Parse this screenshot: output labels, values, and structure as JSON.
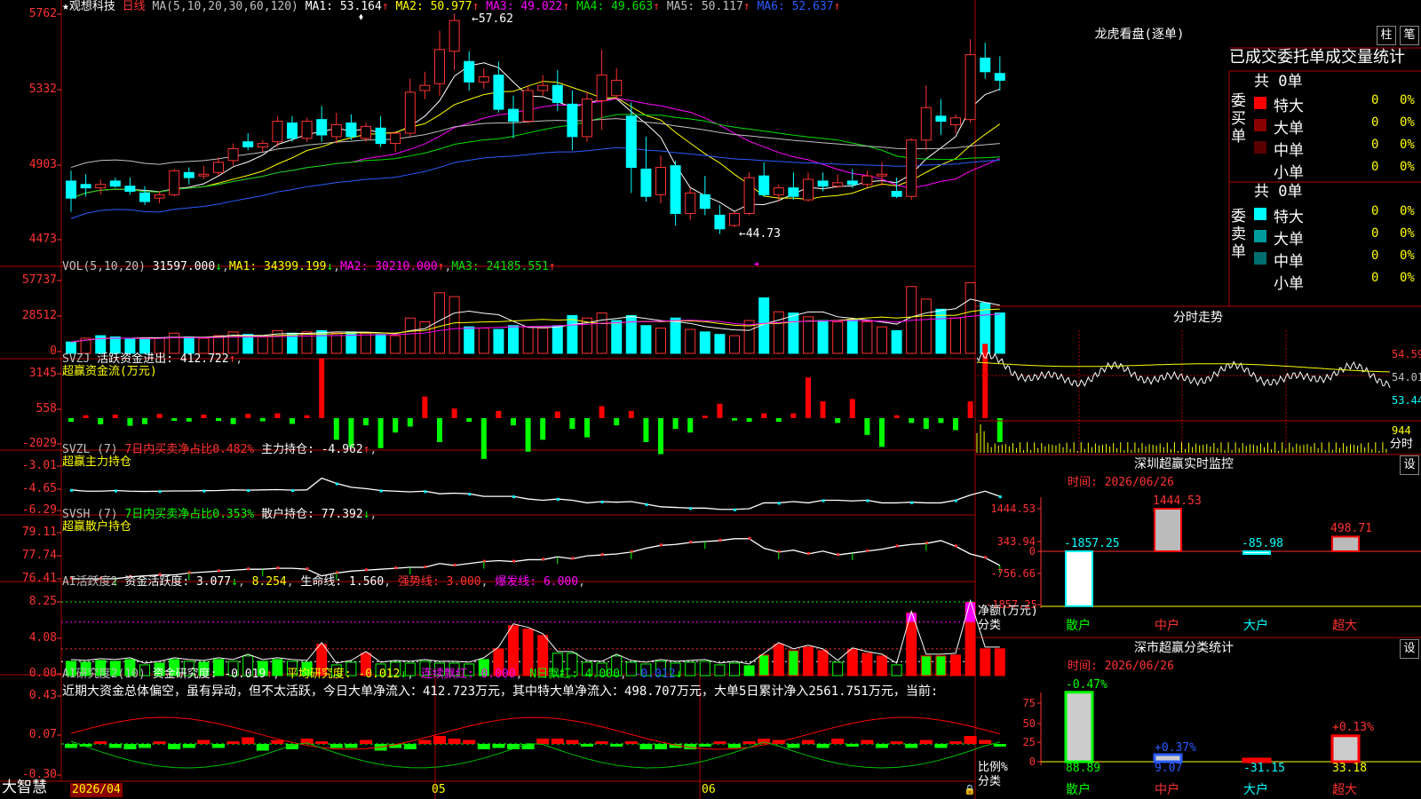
{
  "main": {
    "title_star": "★",
    "stock_name": "观想科技",
    "period": "日线",
    "ma_label": "MA(5,10,20,30,60,120)",
    "ma_values": [
      {
        "t": "MA1: 53.164",
        "c": "#ffffff"
      },
      {
        "t": "MA2: 50.977",
        "c": "#ffff00"
      },
      {
        "t": "MA3: 49.022",
        "c": "#ff00ff"
      },
      {
        "t": "MA4: 49.663",
        "c": "#00e000"
      },
      {
        "t": "MA5: 50.117",
        "c": "#c0c0c0"
      },
      {
        "t": "MA6: 52.637",
        "c": "#2a5cff"
      }
    ],
    "y_ticks": [
      "5762",
      "5332",
      "4903",
      "4473"
    ],
    "high_label": "←57.62",
    "low_label": "←44.73"
  },
  "vol": {
    "label": "VOL(5,10,20)",
    "v": "31597.000",
    "ma1": "MA1: 34399.199",
    "ma2": "MA2: 30210.000",
    "ma3": "MA3: 24185.551",
    "y_ticks": [
      "57737",
      "28512",
      "0"
    ]
  },
  "svzj": {
    "label": "SVZJ",
    "sub": "活跃资金进出: 412.722",
    "title2": "超赢资金流(万元)",
    "y_ticks": [
      "3145",
      "558",
      "-2029"
    ]
  },
  "svzl": {
    "label": "SVZL (7)",
    "sub1": "7日内买卖净占比0.482%",
    "sub2": "主力持仓: -4.962",
    "title2": "超赢主力持仓",
    "y_ticks": [
      "-3.01",
      "-4.65",
      "-6.29"
    ]
  },
  "svsh": {
    "label": "SVSH (7)",
    "sub1": "7日内买卖净占比0.353%",
    "sub2": "散户持仓: 77.392",
    "title2": "超赢散户持仓",
    "y_ticks": [
      "79.11",
      "77.74",
      "76.41"
    ]
  },
  "ai1": {
    "label": "AI活跃度2",
    "a": "资金活跃度: 3.077",
    "b": "8.254",
    "c": "生命线: 1.560",
    "d": "强势线: 3.000",
    "e": "爆发线: 6.000",
    "y_ticks": [
      "8.25",
      "4.08",
      "0.00"
    ]
  },
  "ai2": {
    "label": "AI研究度2(10)",
    "a": "资金研究度: -0.019",
    "b": "平均研究度: -0.012",
    "c": "连续飘红: 0.000",
    "d": "N日飘红: 4.000",
    "e": "-0.012",
    "text": "近期大资金总体偏空，虽有异动，但不太活跃，今日大单净流入：412.723万元，其中特大单净流入：498.707万元，大单5日累计净入2561.751万元，当前:",
    "y_ticks": [
      "0.43",
      "0.07",
      "-0.30"
    ]
  },
  "footer": {
    "brand": "大智慧",
    "date": "2026/04",
    "m5": "05",
    "m6": "06"
  },
  "right": {
    "lhb_title": "龙虎看盘(逐单)",
    "btn1": "柱",
    "btn2": "笔",
    "tabs": "已成交委托单成交量统计",
    "buy_label": "委买单",
    "buy_total": "共 0单",
    "sell_label": "委卖单",
    "sell_total": "共 0单",
    "buy_rows": [
      {
        "n": "特大",
        "c": "#ff0000",
        "v": "0",
        "p": "0%"
      },
      {
        "n": "大单",
        "c": "#8b0000",
        "v": "0",
        "p": "0%"
      },
      {
        "n": "中单",
        "c": "#5a0000",
        "v": "0",
        "p": "0%"
      },
      {
        "n": "小单",
        "c": "#000000",
        "v": "0",
        "p": "0%"
      }
    ],
    "sell_rows": [
      {
        "n": "特大",
        "c": "#00ffff",
        "v": "0",
        "p": "0%"
      },
      {
        "n": "大单",
        "c": "#009c9c",
        "v": "0",
        "p": "0%"
      },
      {
        "n": "中单",
        "c": "#006e6e",
        "v": "0",
        "p": "0%"
      },
      {
        "n": "小单",
        "c": "#000000",
        "v": "0",
        "p": "0%"
      }
    ],
    "fs_title": "分时走势",
    "fs_y": [
      "54.59",
      "54.01",
      "53.44"
    ],
    "fs_vol": "944",
    "fs_tag": "分时",
    "sz_title": "深圳超赢实时监控",
    "sz_btn": "设",
    "sz_time": "时间: 2026/06/26",
    "sz_y": [
      "1444.53",
      "343.94",
      "0",
      "-756.66",
      "-1857.25"
    ],
    "sz_vals": [
      "-1857.25",
      "1444.53",
      "-85.98",
      "498.71"
    ],
    "sz_unit": "净额(万元)",
    "sz_cat": "分类",
    "cats": [
      "散户",
      "中户",
      "大户",
      "超大"
    ],
    "cls_title": "深市超赢分类统计",
    "cls_btn": "设",
    "cls_time": "时间: 2026/06/26",
    "cls_y": [
      "75",
      "50",
      "25",
      "0"
    ],
    "cls_pct": [
      "-0.47%",
      "+0.37%",
      "+0.13%"
    ],
    "cls_vals": [
      "88.89",
      "9.07",
      "-31.15",
      "33.18"
    ],
    "cls_unit": "比例%",
    "cls_cat": "分类"
  },
  "chart_data": [
    {
      "type": "candlestick",
      "title": "观想科技 日线",
      "series": "price",
      "ylim": [
        44.0,
        58.0
      ],
      "x_labels": [
        "2026/04",
        "05",
        "06"
      ],
      "ohlc": [
        [
          47.8,
          48.4,
          46.0,
          46.8
        ],
        [
          47.6,
          48.2,
          46.9,
          47.4
        ],
        [
          47.4,
          47.9,
          47.0,
          47.6
        ],
        [
          47.8,
          48.0,
          47.4,
          47.5
        ],
        [
          47.5,
          48.0,
          47.0,
          47.2
        ],
        [
          47.1,
          47.5,
          46.4,
          46.6
        ],
        [
          46.8,
          47.2,
          46.5,
          47.0
        ],
        [
          47.0,
          48.5,
          46.9,
          48.4
        ],
        [
          48.3,
          48.6,
          47.6,
          48.0
        ],
        [
          48.1,
          48.7,
          47.9,
          48.2
        ],
        [
          48.3,
          49.2,
          48.1,
          48.9
        ],
        [
          49.0,
          50.0,
          48.7,
          49.7
        ],
        [
          50.1,
          50.6,
          49.6,
          49.8
        ],
        [
          49.8,
          50.2,
          49.5,
          50.0
        ],
        [
          50.1,
          51.6,
          49.8,
          51.3
        ],
        [
          51.2,
          51.6,
          50.1,
          50.3
        ],
        [
          50.3,
          51.5,
          50.1,
          51.3
        ],
        [
          51.4,
          52.2,
          50.1,
          50.5
        ],
        [
          50.4,
          51.8,
          50.0,
          51.1
        ],
        [
          51.2,
          51.7,
          50.2,
          50.4
        ],
        [
          50.3,
          51.2,
          50.1,
          51.0
        ],
        [
          50.9,
          51.6,
          49.8,
          50.0
        ],
        [
          50.0,
          50.7,
          49.5,
          50.6
        ],
        [
          50.6,
          53.8,
          50.4,
          53.0
        ],
        [
          53.1,
          54.2,
          52.6,
          53.4
        ],
        [
          53.5,
          56.6,
          52.8,
          55.5
        ],
        [
          55.4,
          57.6,
          54.3,
          57.2
        ],
        [
          54.8,
          55.4,
          53.1,
          53.6
        ],
        [
          53.6,
          54.4,
          53.2,
          53.9
        ],
        [
          54.0,
          54.8,
          51.8,
          52.0
        ],
        [
          52.0,
          52.8,
          50.3,
          51.3
        ],
        [
          51.3,
          53.4,
          51.2,
          53.1
        ],
        [
          53.1,
          54.0,
          52.8,
          53.4
        ],
        [
          53.4,
          54.3,
          51.9,
          52.4
        ],
        [
          52.3,
          53.1,
          49.6,
          50.4
        ],
        [
          50.4,
          53.0,
          50.1,
          52.6
        ],
        [
          52.5,
          55.5,
          50.8,
          54.0
        ],
        [
          52.8,
          54.4,
          52.6,
          53.7
        ],
        [
          51.6,
          52.4,
          47.1,
          48.6
        ],
        [
          48.5,
          50.4,
          46.6,
          46.9
        ],
        [
          47.0,
          49.3,
          46.5,
          48.6
        ],
        [
          48.7,
          49.0,
          45.2,
          45.9
        ],
        [
          45.9,
          47.4,
          45.5,
          47.1
        ],
        [
          47.0,
          48.1,
          45.8,
          46.2
        ],
        [
          45.8,
          46.4,
          44.7,
          45.0
        ],
        [
          45.2,
          46.0,
          45.1,
          45.9
        ],
        [
          45.9,
          48.3,
          45.8,
          48.0
        ],
        [
          48.1,
          48.9,
          46.9,
          47.0
        ],
        [
          47.0,
          47.6,
          46.6,
          47.4
        ],
        [
          47.4,
          48.3,
          46.7,
          46.9
        ],
        [
          46.7,
          48.3,
          46.6,
          47.9
        ],
        [
          47.8,
          48.3,
          47.2,
          47.5
        ],
        [
          47.5,
          48.2,
          47.4,
          47.7
        ],
        [
          47.8,
          48.5,
          47.4,
          47.6
        ],
        [
          47.6,
          48.4,
          47.4,
          48.1
        ],
        [
          48.1,
          48.9,
          47.5,
          48.2
        ],
        [
          47.2,
          48.0,
          46.8,
          46.9
        ],
        [
          46.9,
          50.3,
          46.7,
          50.2
        ],
        [
          50.2,
          53.4,
          49.6,
          52.1
        ],
        [
          51.6,
          52.6,
          50.5,
          51.3
        ],
        [
          51.1,
          51.7,
          50.6,
          51.5
        ],
        [
          51.4,
          56.1,
          51.2,
          55.2
        ],
        [
          55.0,
          55.9,
          53.8,
          54.2
        ],
        [
          54.1,
          55.1,
          53.1,
          53.7
        ]
      ]
    },
    {
      "type": "bar",
      "series": "volume",
      "ylim": [
        0,
        57737
      ],
      "values": [
        9000,
        12000,
        14000,
        13000,
        12000,
        11000,
        12000,
        16000,
        13000,
        12000,
        14000,
        17000,
        15000,
        13000,
        18000,
        16000,
        17000,
        18000,
        16000,
        17000,
        16000,
        15000,
        14000,
        28000,
        25000,
        48000,
        45000,
        21000,
        20000,
        19000,
        22000,
        21000,
        20000,
        22000,
        30000,
        28000,
        32000,
        26000,
        30000,
        22000,
        20000,
        28000,
        19000,
        17000,
        15000,
        14000,
        26000,
        44000,
        33000,
        32000,
        29000,
        26000,
        25000,
        27000,
        25000,
        21000,
        18000,
        53000,
        43000,
        35000,
        28000,
        56000,
        40000,
        32000
      ],
      "up": [
        false,
        true,
        false,
        false,
        false,
        false,
        true,
        true,
        false,
        true,
        true,
        true,
        false,
        true,
        true,
        false,
        true,
        false,
        true,
        false,
        true,
        false,
        true,
        true,
        true,
        true,
        true,
        false,
        true,
        false,
        false,
        true,
        true,
        false,
        false,
        true,
        true,
        false,
        false,
        false,
        true,
        false,
        true,
        false,
        false,
        true,
        true,
        false,
        true,
        false,
        true,
        false,
        true,
        false,
        true,
        true,
        false,
        true,
        true,
        false,
        true,
        true,
        false,
        false
      ]
    },
    {
      "type": "bar",
      "series": "活跃资金进出",
      "ylim": [
        -2029,
        3145
      ],
      "values": [
        -150,
        120,
        -260,
        150,
        -320,
        -250,
        180,
        -110,
        -140,
        150,
        -120,
        -250,
        180,
        -130,
        200,
        -240,
        120,
        2500,
        -900,
        -1200,
        -300,
        -1250,
        -600,
        -350,
        900,
        -1000,
        400,
        -150,
        -1700,
        300,
        -300,
        -1400,
        -900,
        280,
        -450,
        -800,
        500,
        -300,
        300,
        -1000,
        -1500,
        -450,
        -600,
        100,
        600,
        -100,
        -150,
        200,
        -150,
        200,
        1700,
        700,
        -200,
        800,
        -700,
        -1200,
        120,
        -200,
        -450,
        -200,
        -500,
        700,
        3100,
        -1000
      ]
    },
    {
      "type": "line",
      "series": "主力持仓",
      "ylim": [
        -6.29,
        -3.01
      ],
      "values": [
        -4.5,
        -4.6,
        -4.6,
        -4.55,
        -4.6,
        -4.62,
        -4.6,
        -4.58,
        -4.58,
        -4.56,
        -4.55,
        -4.5,
        -4.52,
        -4.5,
        -4.48,
        -4.52,
        -4.5,
        -3.6,
        -4.0,
        -4.3,
        -4.4,
        -4.55,
        -4.6,
        -4.65,
        -4.6,
        -4.8,
        -4.75,
        -4.8,
        -5.0,
        -5.0,
        -5.0,
        -5.2,
        -5.3,
        -5.2,
        -5.3,
        -5.5,
        -5.4,
        -5.45,
        -5.4,
        -5.6,
        -5.8,
        -5.85,
        -5.9,
        -5.9,
        -6.0,
        -6.0,
        -5.95,
        -5.5,
        -5.5,
        -5.4,
        -5.5,
        -5.3,
        -5.3,
        -5.35,
        -5.3,
        -5.5,
        -5.5,
        -5.45,
        -5.5,
        -5.5,
        -5.3,
        -4.9,
        -4.6,
        -5.0
      ]
    },
    {
      "type": "line",
      "series": "散户持仓",
      "ylim": [
        76.41,
        79.11
      ],
      "values": [
        76.6,
        76.6,
        76.6,
        76.6,
        76.7,
        76.75,
        76.8,
        76.8,
        76.9,
        76.95,
        77.0,
        77.05,
        77.1,
        77.1,
        77.15,
        77.15,
        77.1,
        76.75,
        76.9,
        77.0,
        77.05,
        77.1,
        77.15,
        77.2,
        77.2,
        77.4,
        77.3,
        77.4,
        77.5,
        77.55,
        77.5,
        77.6,
        77.6,
        77.75,
        77.65,
        77.8,
        77.85,
        77.9,
        78.0,
        78.2,
        78.35,
        78.4,
        78.5,
        78.55,
        78.6,
        78.7,
        78.7,
        78.2,
        78.0,
        78.1,
        77.9,
        78.05,
        77.85,
        77.95,
        78.05,
        78.15,
        78.3,
        78.4,
        78.45,
        78.6,
        78.3,
        77.9,
        77.7,
        77.3
      ]
    },
    {
      "type": "bar",
      "series": "资金活跃度",
      "ylim": [
        0,
        8.25
      ],
      "values": [
        1.6,
        1.5,
        1.7,
        1.6,
        1.8,
        1.2,
        1.4,
        1.8,
        1.6,
        1.5,
        1.8,
        1.6,
        2.2,
        1.6,
        1.8,
        1.6,
        1.5,
        3.5,
        1.2,
        1.5,
        2.5,
        1.3,
        1.5,
        1.4,
        1.6,
        1.4,
        1.4,
        1.3,
        1.8,
        3.0,
        5.6,
        5.2,
        4.5,
        2.5,
        2.5,
        1.5,
        1.4,
        2.2,
        1.5,
        1.3,
        1.6,
        1.4,
        1.5,
        1.6,
        1.2,
        1.4,
        1.1,
        2.3,
        3.5,
        2.8,
        3.2,
        2.8,
        1.5,
        2.9,
        2.5,
        2.2,
        1.2,
        7.0,
        2.2,
        2.2,
        2.3,
        8.2,
        3.0,
        3.0
      ],
      "strong": [
        false,
        false,
        false,
        false,
        false,
        false,
        false,
        false,
        false,
        false,
        false,
        false,
        false,
        false,
        false,
        false,
        false,
        true,
        false,
        false,
        true,
        false,
        false,
        false,
        false,
        false,
        false,
        false,
        false,
        true,
        true,
        true,
        true,
        false,
        false,
        false,
        false,
        false,
        false,
        false,
        false,
        false,
        false,
        false,
        false,
        false,
        false,
        true,
        true,
        true,
        true,
        true,
        false,
        true,
        true,
        true,
        false,
        true,
        true,
        true,
        true,
        true,
        true,
        true
      ],
      "green": [
        true,
        true,
        true,
        true,
        true,
        false,
        true,
        true,
        false,
        true,
        true,
        false,
        false,
        true,
        true,
        false,
        true,
        false,
        false,
        false,
        false,
        false,
        false,
        false,
        false,
        false,
        false,
        false,
        true,
        false,
        false,
        false,
        false,
        false,
        false,
        false,
        false,
        false,
        false,
        false,
        false,
        false,
        false,
        false,
        false,
        false,
        true,
        true,
        false,
        true,
        false,
        false,
        false,
        false,
        false,
        false,
        false,
        false,
        true,
        true,
        false,
        false,
        false,
        false
      ]
    },
    {
      "type": "bar",
      "series": "资金研究度",
      "ylim": [
        -0.3,
        0.43
      ],
      "values": [
        -0.03,
        -0.02,
        0.02,
        -0.03,
        -0.04,
        -0.03,
        0.02,
        -0.04,
        -0.03,
        0.03,
        -0.03,
        0.02,
        0.05,
        -0.05,
        0.03,
        -0.04,
        0.04,
        0.02,
        -0.03,
        -0.03,
        0.03,
        -0.05,
        -0.03,
        -0.04,
        0.03,
        0.06,
        0.04,
        0.03,
        -0.04,
        -0.03,
        -0.04,
        -0.04,
        0.04,
        0.04,
        0.03,
        -0.02,
        0.02,
        -0.02,
        0.02,
        -0.04,
        -0.04,
        -0.03,
        -0.04,
        -0.02,
        0.02,
        -0.03,
        0.02,
        0.04,
        0.03,
        -0.03,
        0.03,
        -0.03,
        0.04,
        -0.02,
        0.03,
        -0.03,
        0.02,
        -0.03,
        0.03,
        -0.03,
        0.02,
        0.06,
        0.03,
        -0.02
      ]
    }
  ]
}
